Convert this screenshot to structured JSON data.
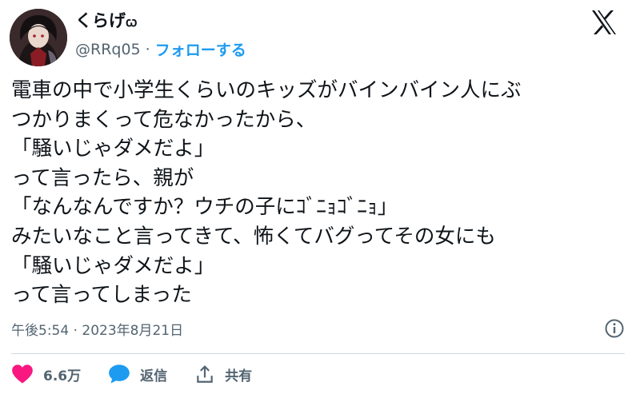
{
  "author": {
    "display_name": "くらげ",
    "display_name_badge": "ꞷ",
    "handle": "@RRq05",
    "separator": "·",
    "follow_label": "フォローする"
  },
  "tweet": {
    "lines": [
      "電車の中で小学生くらいのキッズがバインバイン人にぶ",
      "つかりまくって危なかったから、",
      "「騒いじゃダメだよ」",
      "って言ったら、親が",
      "「なんなんですか？ウチの子にｺﾞﾆｮｺﾞﾆｮ」",
      "みたいなこと言ってきて、怖くてバグってその女にも",
      "「騒いじゃダメだよ」",
      "って言ってしまった"
    ],
    "timestamp": "午後5:54 · 2023年8月21日"
  },
  "actions": {
    "like_count": "6.6万",
    "reply_label": "返信",
    "share_label": "共有"
  },
  "colors": {
    "like": "#f91880",
    "reply": "#1d9bf0",
    "follow": "#1d9bf0",
    "secondary_text": "#536471"
  }
}
